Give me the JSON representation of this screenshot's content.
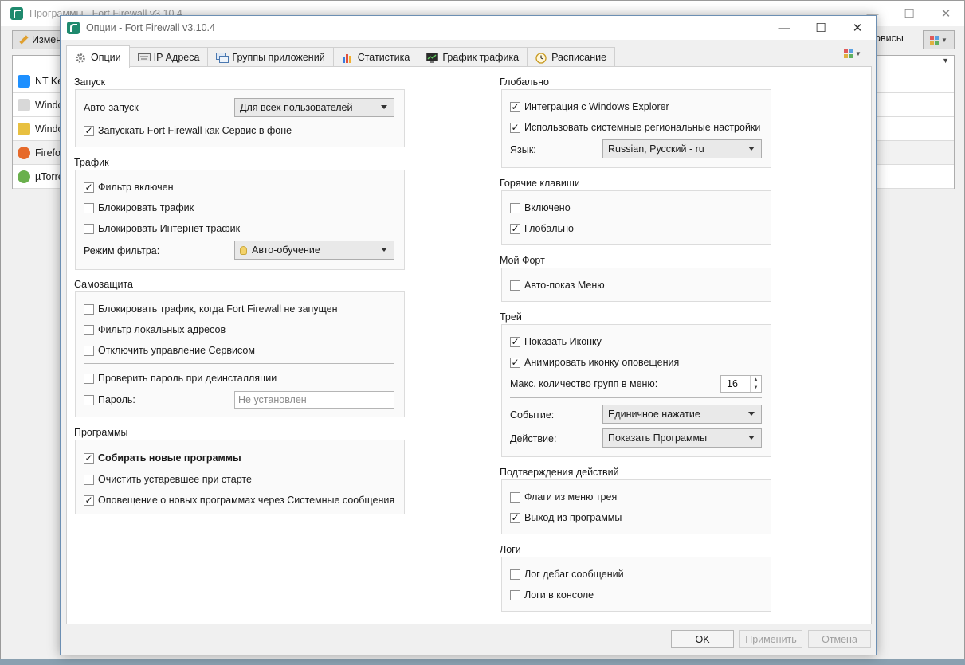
{
  "main_window": {
    "title": "Программы - Fort Firewall v3.10.4",
    "edit_button": "Измени",
    "services_button": "рвисы",
    "program_rows": [
      "NT Ke",
      "Windo",
      "Windo",
      "Firefox",
      "µTorre"
    ]
  },
  "dialog": {
    "title": "Опции - Fort Firewall v3.10.4",
    "window_controls": {
      "minimize": "—",
      "maximize": "☐",
      "close": "✕"
    },
    "tabs": [
      {
        "label": "Опции",
        "icon": "gear-icon"
      },
      {
        "label": "IP Адреса",
        "icon": "keyboard-icon"
      },
      {
        "label": "Группы приложений",
        "icon": "windows-icon"
      },
      {
        "label": "Статистика",
        "icon": "bar-chart-icon"
      },
      {
        "label": "График трафика",
        "icon": "monitor-graph-icon"
      },
      {
        "label": "Расписание",
        "icon": "clock-icon"
      }
    ],
    "buttons": {
      "ok": "OK",
      "apply": "Применить",
      "cancel": "Отмена"
    }
  },
  "left": {
    "startup": {
      "title": "Запуск",
      "autostart_label": "Авто-запуск",
      "autostart_value": "Для всех пользователей",
      "run_as_service": {
        "label": "Запускать Fort Firewall как Сервис в фоне",
        "checked": true
      }
    },
    "traffic": {
      "title": "Трафик",
      "filter_enabled": {
        "label": "Фильтр включен",
        "checked": true
      },
      "block_traffic": {
        "label": "Блокировать трафик",
        "checked": false
      },
      "block_inet": {
        "label": "Блокировать Интернет трафик",
        "checked": false
      },
      "filter_mode_label": "Режим фильтра:",
      "filter_mode_value": "Авто-обучение"
    },
    "protection": {
      "title": "Самозащита",
      "block_when_not_running": {
        "label": "Блокировать трафик, когда Fort Firewall не запущен",
        "checked": false
      },
      "filter_local": {
        "label": "Фильтр локальных адресов",
        "checked": false
      },
      "disable_service_control": {
        "label": "Отключить управление Сервисом",
        "checked": false
      },
      "check_password_uninstall": {
        "label": "Проверить пароль при деинсталляции",
        "checked": false
      },
      "password": {
        "label": "Пароль:",
        "checked": false
      },
      "password_placeholder": "Не установлен"
    },
    "programs": {
      "title": "Программы",
      "collect_new": {
        "label": "Собирать новые программы",
        "checked": true
      },
      "purge_obsolete": {
        "label": "Очистить устаревшее при старте",
        "checked": false
      },
      "notify_new": {
        "label": "Оповещение о новых программах через Системные сообщения",
        "checked": true
      }
    }
  },
  "right": {
    "global": {
      "title": "Глобально",
      "explorer": {
        "label": "Интеграция с Windows Explorer",
        "checked": true
      },
      "regional": {
        "label": "Использовать системные региональные настройки",
        "checked": true
      },
      "lang_label": "Язык:",
      "lang_value": "Russian, Русский - ru"
    },
    "hotkeys": {
      "title": "Горячие клавиши",
      "enabled": {
        "label": "Включено",
        "checked": false
      },
      "global": {
        "label": "Глобально",
        "checked": true
      }
    },
    "myfort": {
      "title": "Мой Форт",
      "autoshow_menu": {
        "label": "Авто-показ Меню",
        "checked": false
      }
    },
    "tray": {
      "title": "Трей",
      "show_icon": {
        "label": "Показать Иконку",
        "checked": true
      },
      "animate_icon": {
        "label": "Анимировать иконку оповещения",
        "checked": true
      },
      "max_groups_label": "Макс. количество групп в меню:",
      "max_groups_value": "16",
      "event_label": "Событие:",
      "event_value": "Единичное нажатие",
      "action_label": "Действие:",
      "action_value": "Показать Программы"
    },
    "confirm": {
      "title": "Подтверждения действий",
      "tray_flags": {
        "label": "Флаги из меню трея",
        "checked": false
      },
      "app_exit": {
        "label": "Выход из программы",
        "checked": true
      }
    },
    "logs": {
      "title": "Логи",
      "debug": {
        "label": "Лог дебаг сообщений",
        "checked": false
      },
      "console": {
        "label": "Логи в консоле",
        "checked": false
      }
    }
  },
  "colors": {
    "accent": "#1f8a6e",
    "dialog_border": "#6c8fb3"
  }
}
